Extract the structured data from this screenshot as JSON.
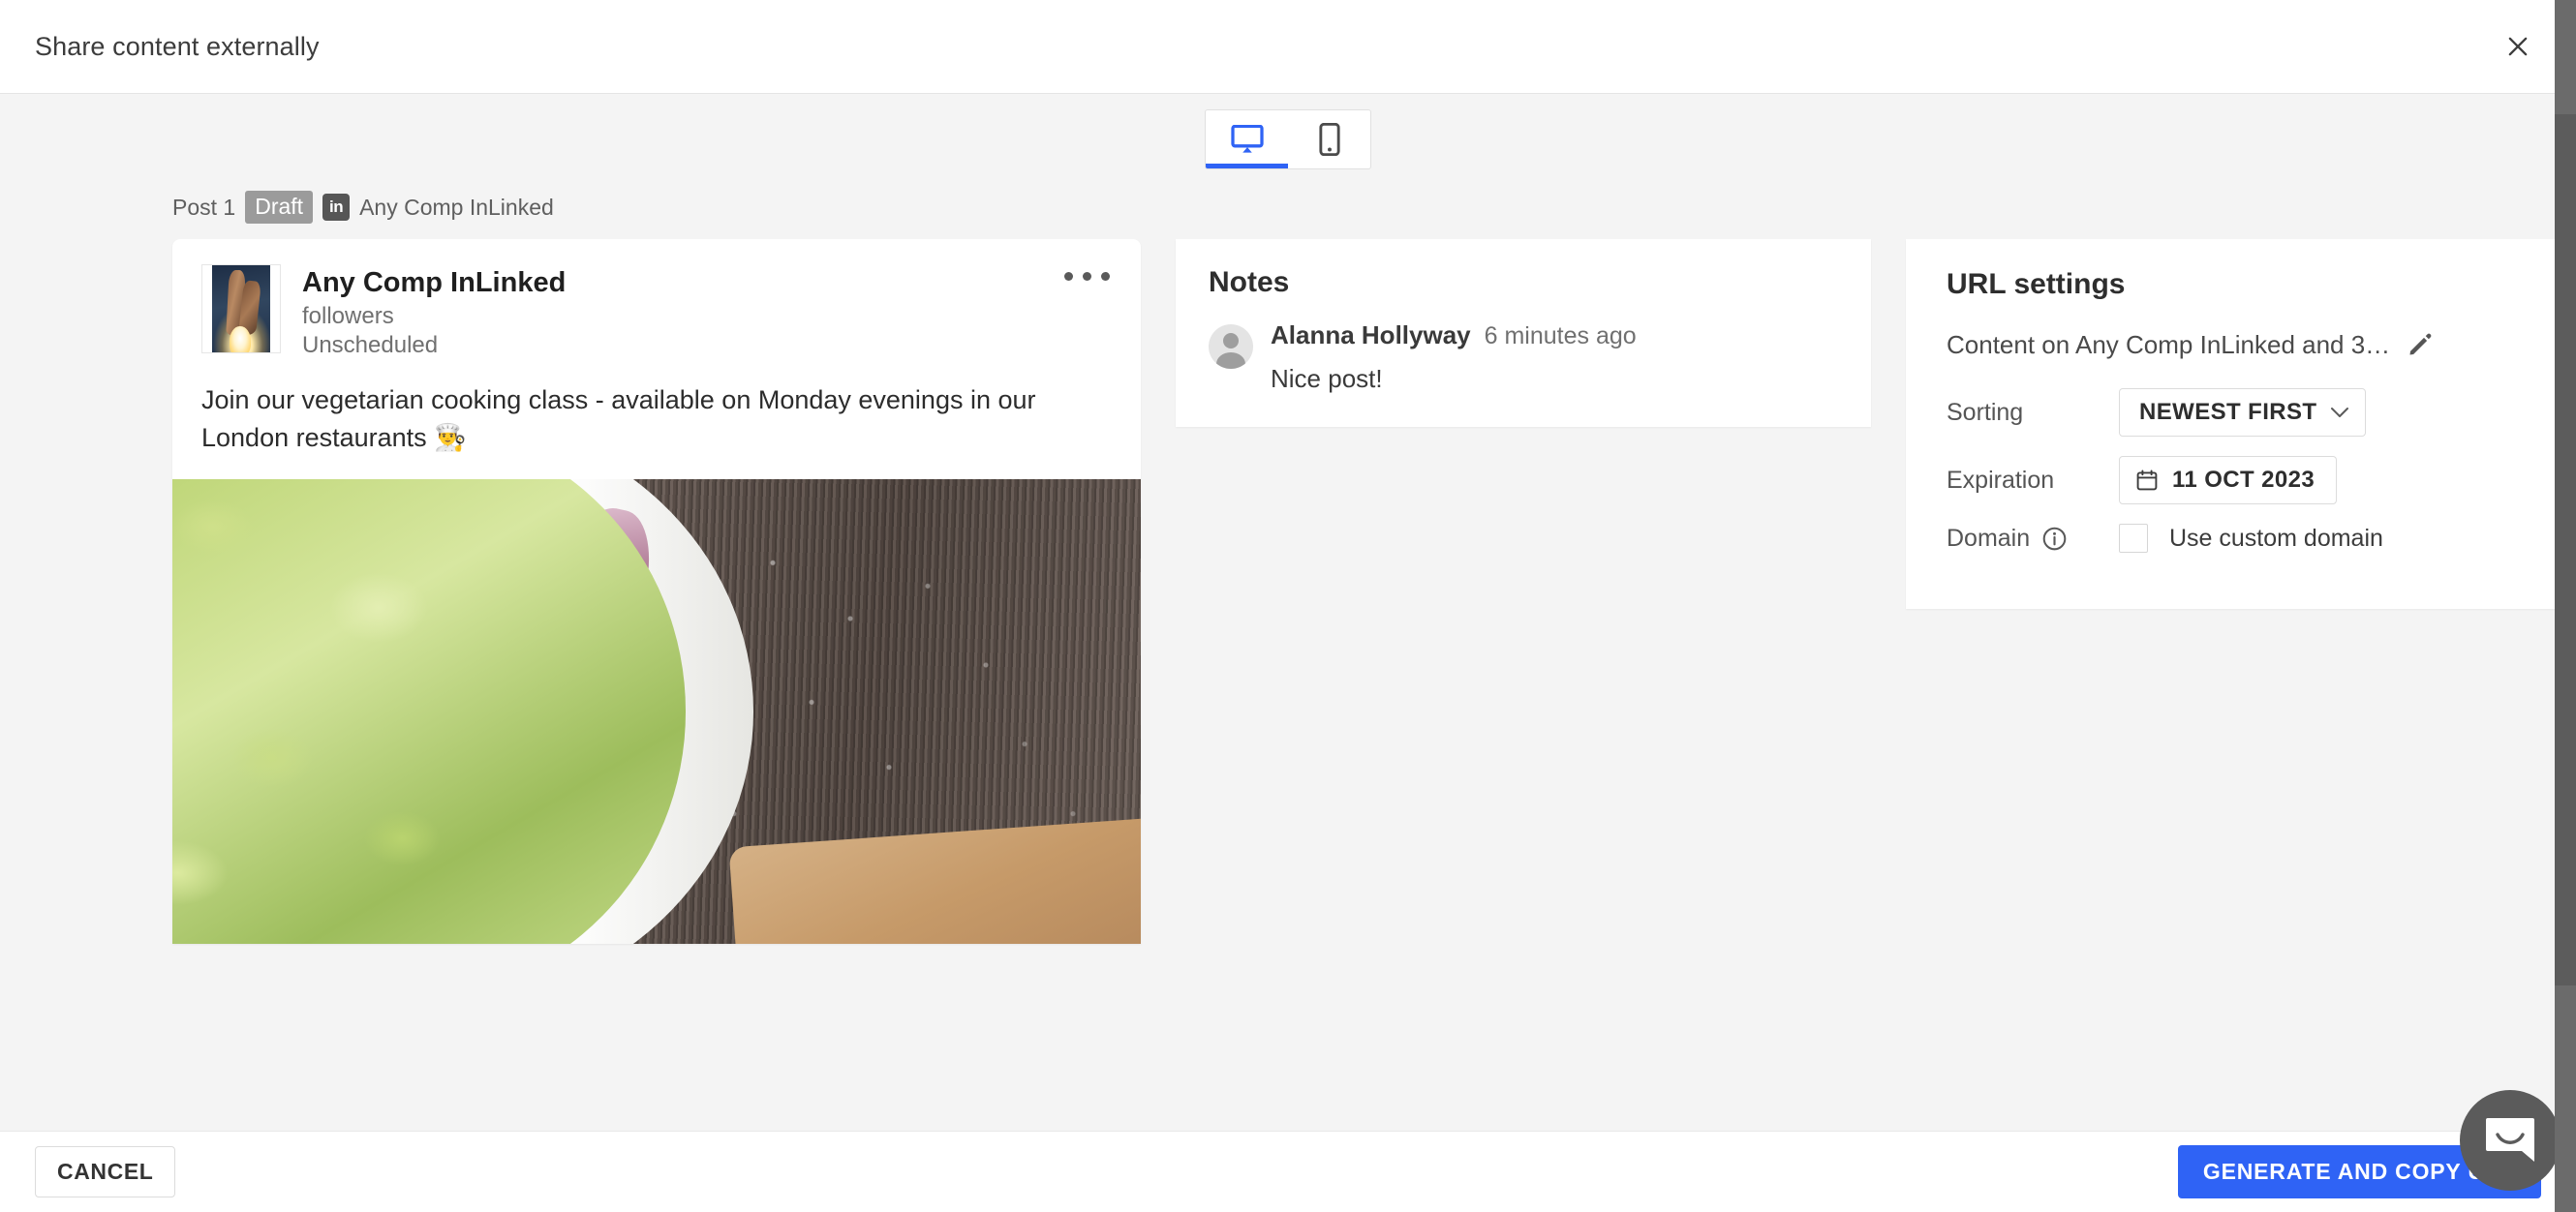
{
  "header": {
    "title": "Share content externally",
    "close_icon": "close-icon"
  },
  "device_tabs": [
    {
      "id": "desktop",
      "icon": "desktop-monitor-icon",
      "active": true
    },
    {
      "id": "mobile",
      "icon": "mobile-phone-icon",
      "active": false
    }
  ],
  "post_meta": {
    "post_label": "Post 1",
    "status_badge": "Draft",
    "network_icon": "linkedin-icon",
    "network_icon_text": "in",
    "channel_name": "Any Comp InLinked"
  },
  "post_card": {
    "author_name": "Any Comp InLinked",
    "followers": "followers",
    "schedule_status": "Unscheduled",
    "menu_icon": "more-options-icon",
    "avatar_icon": "rocket-launch-avatar",
    "text": "Join our vegetarian cooking class - available on Monday evenings in our London restaurants 👨‍🍳",
    "media_alt": "salad-bowl-photo"
  },
  "notes": {
    "title": "Notes",
    "items": [
      {
        "avatar_icon": "person-avatar-icon",
        "author": "Alanna Hollyway",
        "time": "6 minutes ago",
        "text": "Nice post!"
      }
    ]
  },
  "url_settings": {
    "title": "URL settings",
    "name": "Content on Any Comp InLinked and 3…",
    "edit_icon": "pencil-edit-icon",
    "sorting": {
      "label": "Sorting",
      "value": "NEWEST FIRST",
      "chevron_icon": "chevron-down-icon",
      "options": [
        "NEWEST FIRST"
      ]
    },
    "expiration": {
      "label": "Expiration",
      "value": "11 OCT 2023",
      "calendar_icon": "calendar-icon"
    },
    "domain": {
      "label": "Domain",
      "info_icon": "info-icon",
      "checkbox_label": "Use custom domain",
      "checked": false
    }
  },
  "footer": {
    "cancel_label": "CANCEL",
    "primary_label": "GENERATE AND COPY URL"
  },
  "chat": {
    "icon": "chat-bubble-smile-icon"
  },
  "colors": {
    "accent_blue": "#2f63f5",
    "badge_gray": "#9b9b9b",
    "page_bg": "#f4f4f4",
    "chat_gray": "#5b5b5b"
  }
}
